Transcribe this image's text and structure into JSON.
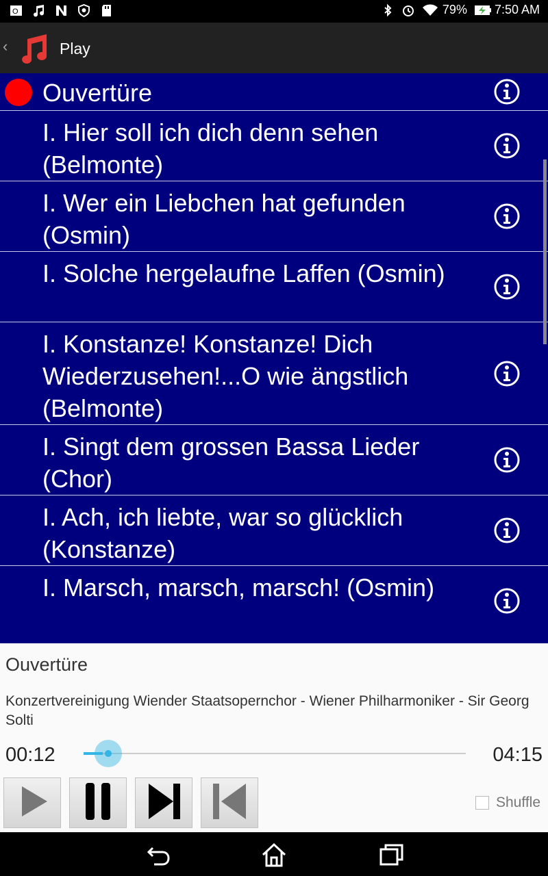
{
  "status_bar": {
    "left_icons": [
      "outlook-icon",
      "music-note-icon",
      "news-icon",
      "shield-icon",
      "sd-card-icon"
    ],
    "right_icons": [
      "bluetooth-icon",
      "alarm-icon",
      "wifi-icon"
    ],
    "battery": "79%",
    "time": "7:50 AM"
  },
  "app_bar": {
    "back_icon": "chevron-left-icon",
    "logo_icon": "music-note-icon",
    "title": "Play"
  },
  "playlist": {
    "items": [
      {
        "title": "Ouvertüre",
        "playing": true
      },
      {
        "title": "I. Hier soll ich dich denn sehen (Belmonte)",
        "playing": false
      },
      {
        "title": "I. Wer ein Liebchen hat gefunden (Osmin)",
        "playing": false
      },
      {
        "title": "I. Solche hergelaufne Laffen (Osmin)",
        "playing": false
      },
      {
        "title": "I. Konstanze! Konstanze! Dich Wiederzusehen!...O wie ängstlich (Belmonte)",
        "playing": false
      },
      {
        "title": "I. Singt dem grossen Bassa Lieder (Chor)",
        "playing": false
      },
      {
        "title": "I. Ach, ich liebte, war so glücklich (Konstanze)",
        "playing": false
      },
      {
        "title": "I. Marsch, marsch, marsch! (Osmin)",
        "playing": false
      }
    ],
    "info_icon": "info-icon",
    "playing_indicator": "red-dot-icon"
  },
  "now_playing": {
    "title": "Ouvertüre",
    "artist": "Konzertvereinigung Wiender Staatsopernchor - Wiener Philharmoniker - Sir Georg Solti",
    "elapsed": "00:12",
    "duration": "04:15",
    "progress_fraction": 0.05
  },
  "controls": {
    "buttons": [
      "play-icon",
      "pause-icon",
      "next-icon",
      "previous-icon"
    ],
    "shuffle_label": "Shuffle",
    "shuffle_checked": false
  },
  "nav_bar": {
    "icons": [
      "back-icon",
      "home-icon",
      "recents-icon"
    ]
  },
  "colors": {
    "list_background": "#00007f",
    "playing_dot": "#ff0000",
    "seek_accent": "#33b5e5"
  }
}
